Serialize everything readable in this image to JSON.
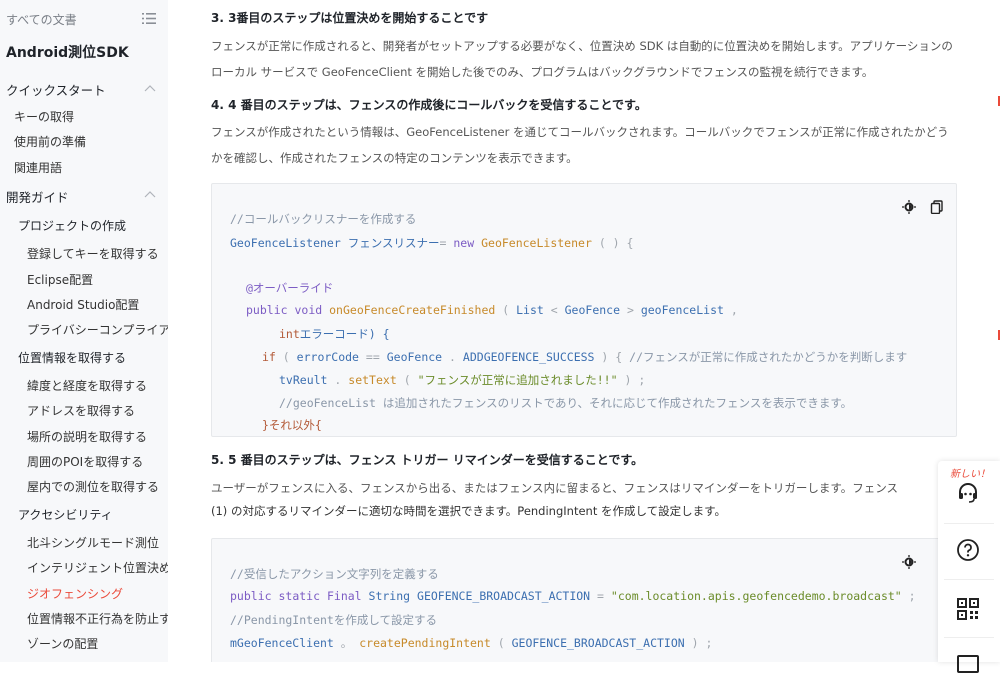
{
  "sidebar": {
    "all_docs": "すべての文書",
    "product": "Android測位SDK",
    "sections": [
      {
        "label": "クイックスタート"
      },
      {
        "label": "開発ガイド"
      }
    ],
    "quick_items": [
      "キーの取得",
      "使用前の準備",
      "関連用語"
    ],
    "project": {
      "label": "プロジェクトの作成",
      "items": [
        "登録してキーを取得する",
        "Eclipse配置",
        "Android Studio配置",
        "プライバシーコンプライア"
      ]
    },
    "location": {
      "label": "位置情報を取得する",
      "items": [
        "緯度と経度を取得する",
        "アドレスを取得する",
        "場所の説明を取得する",
        "周囲のPOIを取得する",
        "屋内での測位を取得する"
      ]
    },
    "accessibility": {
      "label": "アクセシビリティ",
      "items": [
        "北斗シングルモード測位",
        "インテリジェント位置決め",
        "ジオフェンシング",
        "位置情報不正行為を防止す",
        "ゾーンの配置"
      ]
    }
  },
  "content": {
    "step3_title": "3. 3番目のステップは位置決めを開始することです",
    "step3_body": "フェンスが正常に作成されると、開発者がセットアップする必要がなく、位置決め SDK は自動的に位置決めを開始します。アプリケーションのローカル サービスで GeoFenceClient を開始した後でのみ、プログラムはバックグラウンドでフェンスの監視を続行できます。",
    "step4_title": "4. 4 番目のステップは、フェンスの作成後にコールバックを受信することです。",
    "step4_body": "フェンスが作成されたという情報は、GeoFenceListener を通じてコールバックされます。コールバックでフェンスが正常に作成されたかどうかを確認し、作成されたフェンスの特定のコンテンツを表示できます。",
    "code1": {
      "l1": "//コールバックリスナーを作成する",
      "l2_type": "GeoFenceListener",
      "l2_var": "フェンスリスナー",
      "l2_op": "=",
      "l2_new": "new",
      "l2_ctor": "GeoFenceListener",
      "l2_tail": "( ) {",
      "l3": "@オーバーライド",
      "l4_pub": "public",
      "l4_void": "void",
      "l4_fn": "onGeoFenceCreateFinished",
      "l4_p1": "(",
      "l4_list": "List",
      "l4_lt": "<",
      "l4_gf": "GeoFence",
      "l4_gt": ">",
      "l4_var": "geoFenceList",
      "l4_comma": ",",
      "l5_int": "int",
      "l5_rest": "エラーコード) {",
      "l6_if": "if",
      "l6_p": "(",
      "l6_var": "errorCode",
      "l6_eq": "==",
      "l6_cls": "GeoFence",
      "l6_dot": ".",
      "l6_const": "ADDGEOFENCE_SUCCESS",
      "l6_close": ") {",
      "l6_cmt": "//フェンスが正常に作成されたかどうかを判断します",
      "l7_obj": "tvReult",
      "l7_dot": ".",
      "l7_fn": "setText",
      "l7_p": "(",
      "l7_str": "\"フェンスが正常に追加されました!!\"",
      "l7_end": ") ;",
      "l8": "//geoFenceList は追加されたフェンスのリストであり、それに応じて作成されたフェンスを表示できます。",
      "l9": "}それ以外{"
    },
    "step5_title": "5. 5 番目のステップは、フェンス トリガー リマインダーを受信することです。",
    "step5_body_1": "ユーザーがフェンスに入る、フェンスから出る、またはフェンス内に留まると、フェンスはリマインダーをトリガーします。フェンス",
    "step5_body_2": "(1) の対応するリマインダーに適切な時間を選択できます。PendingIntent を作成して設定します。",
    "code2": {
      "l1": "//受信したアクション文字列を定義する",
      "l2_pub": "public",
      "l2_static": "static",
      "l2_final": "Final",
      "l2_type": "String",
      "l2_const": "GEOFENCE_BROADCAST_ACTION",
      "l2_eq": "=",
      "l2_str": "\"com.location.apis.geofencedemo.broadcast\"",
      "l2_end": ";",
      "l3": "//PendingIntentを作成して設定する",
      "l4_obj": "mGeoFenceClient",
      "l4_dot": "。",
      "l4_fn": "createPendingIntent",
      "l4_p": "(",
      "l4_const": "GEOFENCE_BROADCAST_ACTION",
      "l4_end": ") ;"
    }
  },
  "rail": {
    "new_badge": "新しい！"
  },
  "colors": {
    "accent": "#ea4a3a",
    "sidebar_bg": "#f7f8fa",
    "code_bg": "#f7f8fa"
  }
}
